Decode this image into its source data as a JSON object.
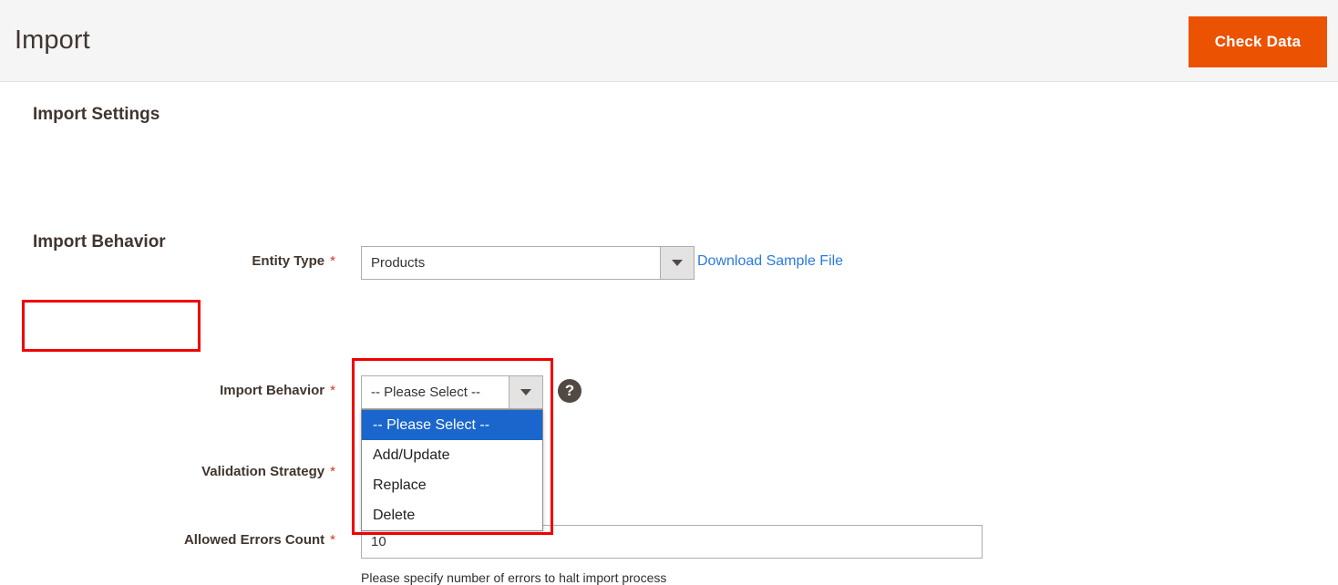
{
  "header": {
    "title": "Import",
    "check_data_label": "Check Data",
    "accent_color": "#eb5202"
  },
  "sections": {
    "import_settings_title": "Import Settings",
    "import_behavior_title": "Import Behavior"
  },
  "fields": {
    "entity_type": {
      "label": "Entity Type",
      "required_marker": "*",
      "value": "Products",
      "sample_link": "Download Sample File"
    },
    "import_behavior": {
      "label": "Import Behavior",
      "required_marker": "*",
      "value": "-- Please Select --",
      "help_icon_glyph": "?",
      "options": [
        "-- Please Select --",
        "Add/Update",
        "Replace",
        "Delete"
      ],
      "selected_index": 0
    },
    "validation_strategy": {
      "label": "Validation Strategy",
      "required_marker": "*",
      "value": ""
    },
    "allowed_errors_count": {
      "label": "Allowed Errors Count",
      "required_marker": "*",
      "value": "10",
      "note": "Please specify number of errors to halt import process"
    }
  },
  "annotations": {
    "highlight_color": "#f00000",
    "boxes": [
      "import-behavior-heading",
      "import-behavior-dropdown"
    ]
  }
}
